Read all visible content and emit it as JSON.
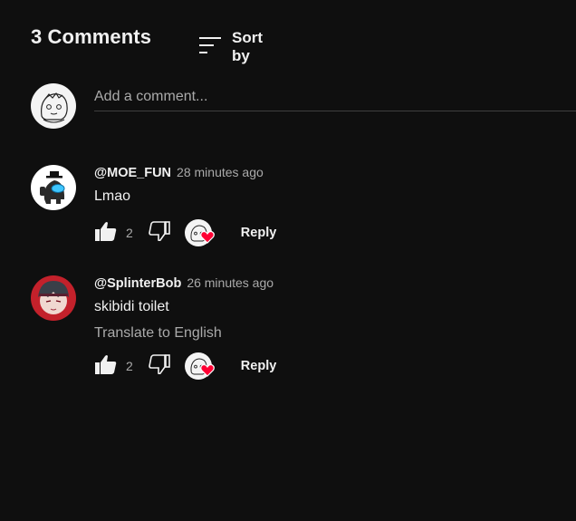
{
  "header": {
    "count_label": "3 Comments",
    "sort_label": "Sort by"
  },
  "add_comment": {
    "placeholder": "Add a comment..."
  },
  "comments": [
    {
      "author": "@MOE_FUN",
      "time": "28 minutes ago",
      "text": "Lmao",
      "likes": "2",
      "reply_label": "Reply",
      "hearted": true
    },
    {
      "author": "@SplinterBob",
      "time": "26 minutes ago",
      "text": "skibidi toilet",
      "translate_label": "Translate to English",
      "likes": "2",
      "reply_label": "Reply",
      "hearted": true
    }
  ],
  "colors": {
    "background": "#0f0f0f",
    "text": "#f1f1f1",
    "secondary": "#aaaaaa",
    "heart": "#ff0033"
  },
  "icons": [
    "sort-icon",
    "thumb-up-icon",
    "thumb-down-icon",
    "heart-icon"
  ]
}
